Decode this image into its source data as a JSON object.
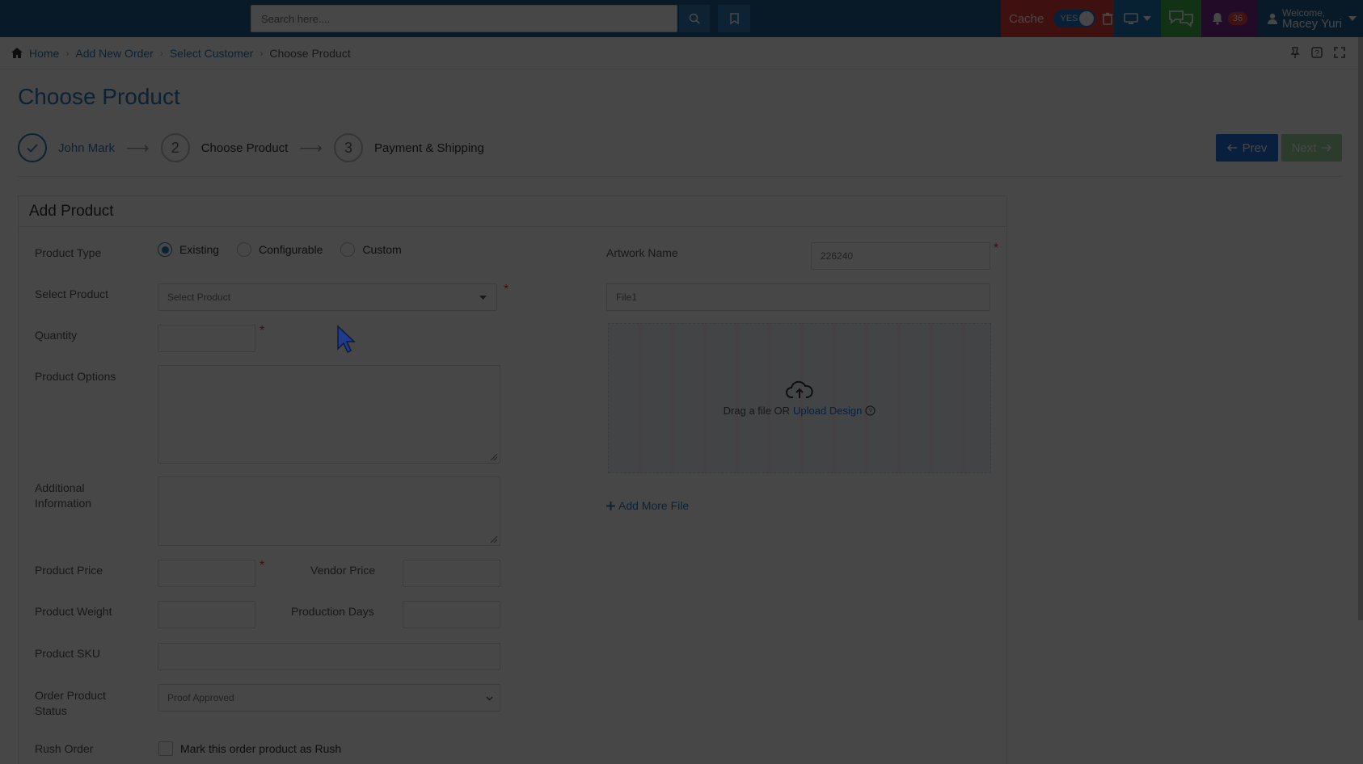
{
  "header": {
    "search_placeholder": "Search here....",
    "cache_label": "Cache",
    "cache_toggle": "YES",
    "notification_count": "36",
    "welcome": "Welcome,",
    "user_name": "Macey Yuri"
  },
  "breadcrumb": {
    "items": [
      "Home",
      "Add New Order",
      "Select Customer",
      "Choose Product"
    ]
  },
  "page": {
    "title": "Choose Product"
  },
  "steps": [
    {
      "number": "",
      "label": "John Mark",
      "status": "done"
    },
    {
      "number": "2",
      "label": "Choose Product",
      "status": "active"
    },
    {
      "number": "3",
      "label": "Payment & Shipping",
      "status": "pending"
    }
  ],
  "nav": {
    "prev_label": "Prev",
    "next_label": "Next"
  },
  "panel": {
    "title": "Add Product",
    "product_type_label": "Product Type",
    "product_type_options": [
      "Existing",
      "Configurable",
      "Custom"
    ],
    "product_type_selected": "Existing",
    "select_product_label": "Select Product",
    "select_product_placeholder": "Select Product",
    "quantity_label": "Quantity",
    "product_options_label": "Product Options",
    "additional_info_label": "Additional Information",
    "product_price_label": "Product Price",
    "vendor_price_label": "Vendor Price",
    "product_weight_label": "Product Weight",
    "production_days_label": "Production Days",
    "product_sku_label": "Product SKU",
    "order_status_label": "Order Product Status",
    "order_status_value": "Proof Approved",
    "rush_order_label": "Rush Order",
    "rush_order_checkbox": "Mark this order product as Rush",
    "artwork_name_label": "Artwork Name",
    "artwork_name_value": "226240",
    "file_name_value": "File1",
    "drop_text": "Drag a file OR",
    "upload_link": "Upload Design",
    "add_more_file": "Add More File",
    "required_mark": "*"
  },
  "colors": {
    "topbar": "#1f5f8b",
    "accent": "#2a7ab8",
    "cache": "#e23a3a",
    "chat": "#3fb24b",
    "notifications": "#7a2a8e",
    "prev": "#1e6fd9",
    "next": "#4caf50"
  }
}
